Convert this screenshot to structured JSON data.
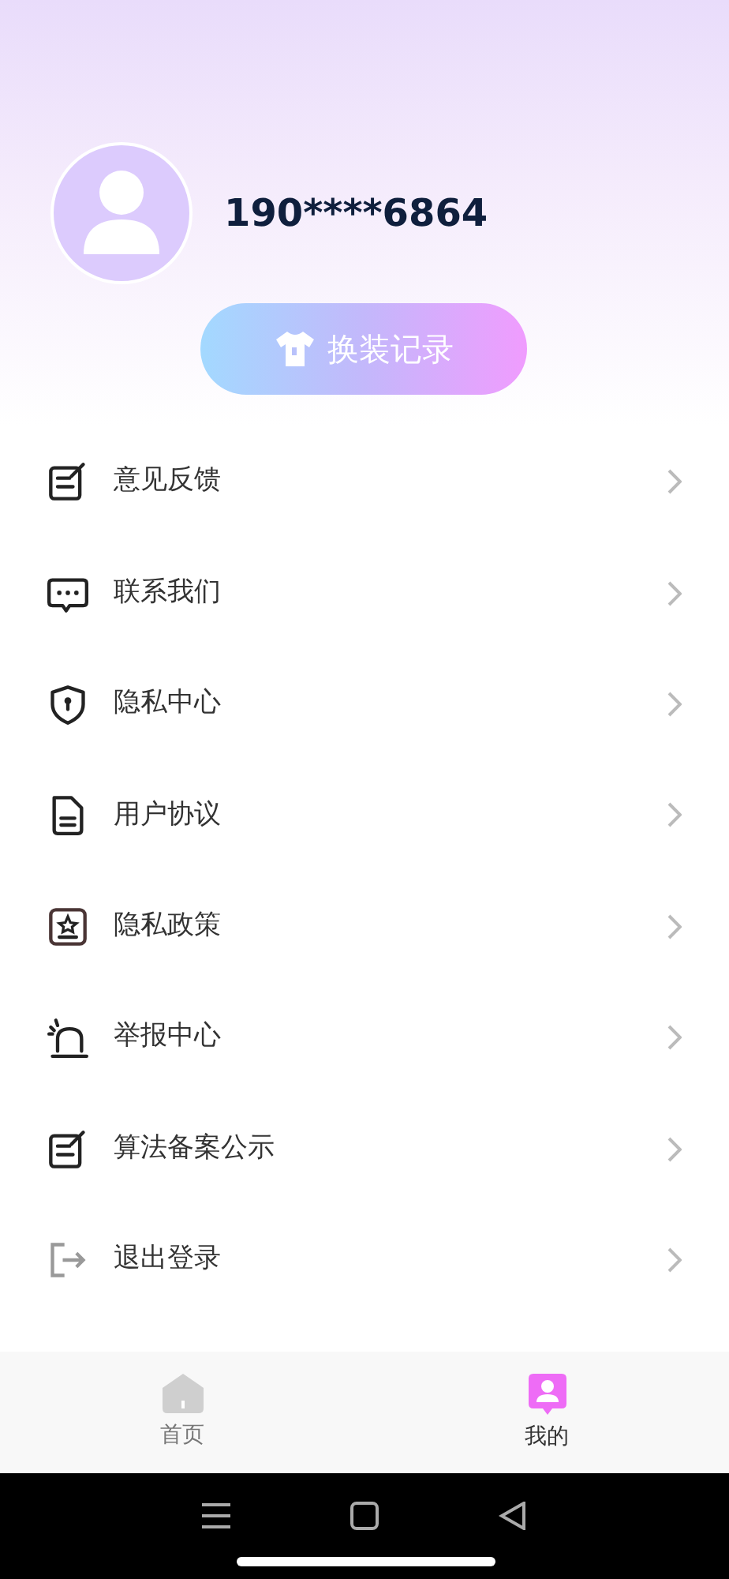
{
  "profile": {
    "phone": "190****6864"
  },
  "outfit_button": {
    "label": "换装记录"
  },
  "menu": [
    {
      "label": "意见反馈"
    },
    {
      "label": "联系我们"
    },
    {
      "label": "隐私中心"
    },
    {
      "label": "用户协议"
    },
    {
      "label": "隐私政策"
    },
    {
      "label": "举报中心"
    },
    {
      "label": "算法备案公示"
    },
    {
      "label": "退出登录"
    }
  ],
  "tab_bar": [
    {
      "label": "首页",
      "selected": false
    },
    {
      "label": "我的",
      "selected": true
    }
  ]
}
